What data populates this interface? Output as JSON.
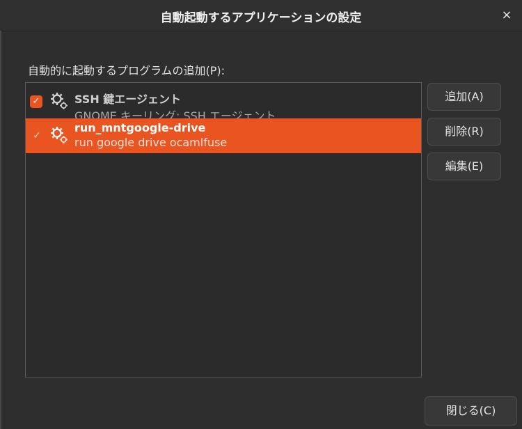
{
  "window": {
    "title": "自動起動するアプリケーションの設定",
    "close_glyph": "×"
  },
  "section": {
    "label": "自動的に起動するプログラムの追加(P):"
  },
  "programs": [
    {
      "name": "SSH 鍵エージェント",
      "description": "GNOME キーリング: SSH エージェント",
      "enabled": true,
      "selected": false,
      "icon": "gear-icon"
    },
    {
      "name": "run_mntgoogle-drive",
      "description": "run google drive ocamlfuse",
      "enabled": true,
      "selected": true,
      "icon": "gear-icon"
    }
  ],
  "buttons": {
    "add": "追加(A)",
    "remove": "削除(R)",
    "edit": "編集(E)",
    "close": "閉じる(C)"
  },
  "colors": {
    "accent": "#e95420",
    "background": "#2e2e2e"
  }
}
